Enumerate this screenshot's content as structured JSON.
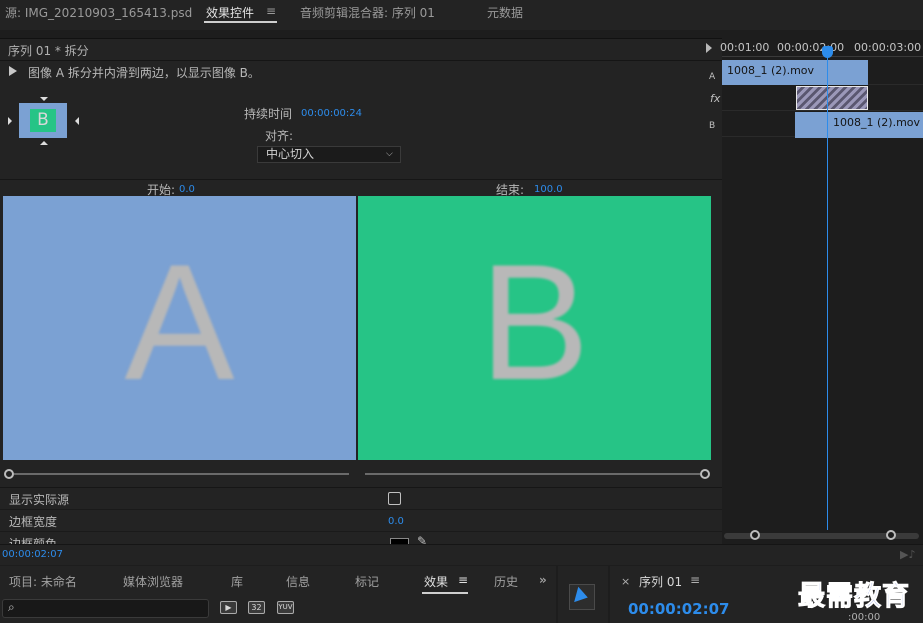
{
  "top_tabs": {
    "source": "源: IMG_20210903_165413.psd",
    "effect_controls": "效果控件",
    "menu_glyph": "≡",
    "audio_mixer": "音频剪辑混合器: 序列 01",
    "metadata": "元数据"
  },
  "effect_controls": {
    "header_title": "序列 01 * 拆分",
    "description": "图像 A 拆分并内滑到两边，以显示图像 B。",
    "thumbnail_letter": "B",
    "duration_label": "持续时间",
    "duration_value": "00:00:00:24",
    "align_label": "对齐:",
    "align_value": "中心切入",
    "start_label": "开始:",
    "start_value": "0.0",
    "end_label": "结束:",
    "end_value": "100.0",
    "preview_a_letter": "A",
    "preview_b_letter": "B",
    "properties": {
      "show_actual_sources": "显示实际源",
      "border_width_label": "边框宽度",
      "border_width_value": "0.0",
      "border_color_label": "边框颜色"
    },
    "timecode": "00:00:02:07"
  },
  "timeline": {
    "ruler": [
      "00:01:00",
      "00:00:02:00",
      "00:00:03:00"
    ],
    "track_a_label": "A",
    "track_fx_label": "fx",
    "track_b_label": "B",
    "clip_a": "1008_1 (2).mov",
    "clip_b": "1008_1 (2).mov"
  },
  "bottom_tabs": {
    "project": "项目: 未命名",
    "media_browser": "媒体浏览器",
    "library": "库",
    "info": "信息",
    "markers": "标记",
    "effects": "效果",
    "menu_glyph": "≡",
    "history": "历史",
    "overflow": "»",
    "bin_icons": [
      "▶",
      "32",
      "YUV"
    ]
  },
  "sequence": {
    "close": "×",
    "title": "序列 01",
    "menu_glyph": "≡",
    "timecode": "00:00:02:07",
    "small_time": ":00:00"
  },
  "watermark": "最需教育",
  "colors": {
    "accent_blue": "#2d8ceb",
    "clip_blue": "#7ba1d3",
    "preview_green": "#26c486",
    "panel_bg": "#232323"
  }
}
